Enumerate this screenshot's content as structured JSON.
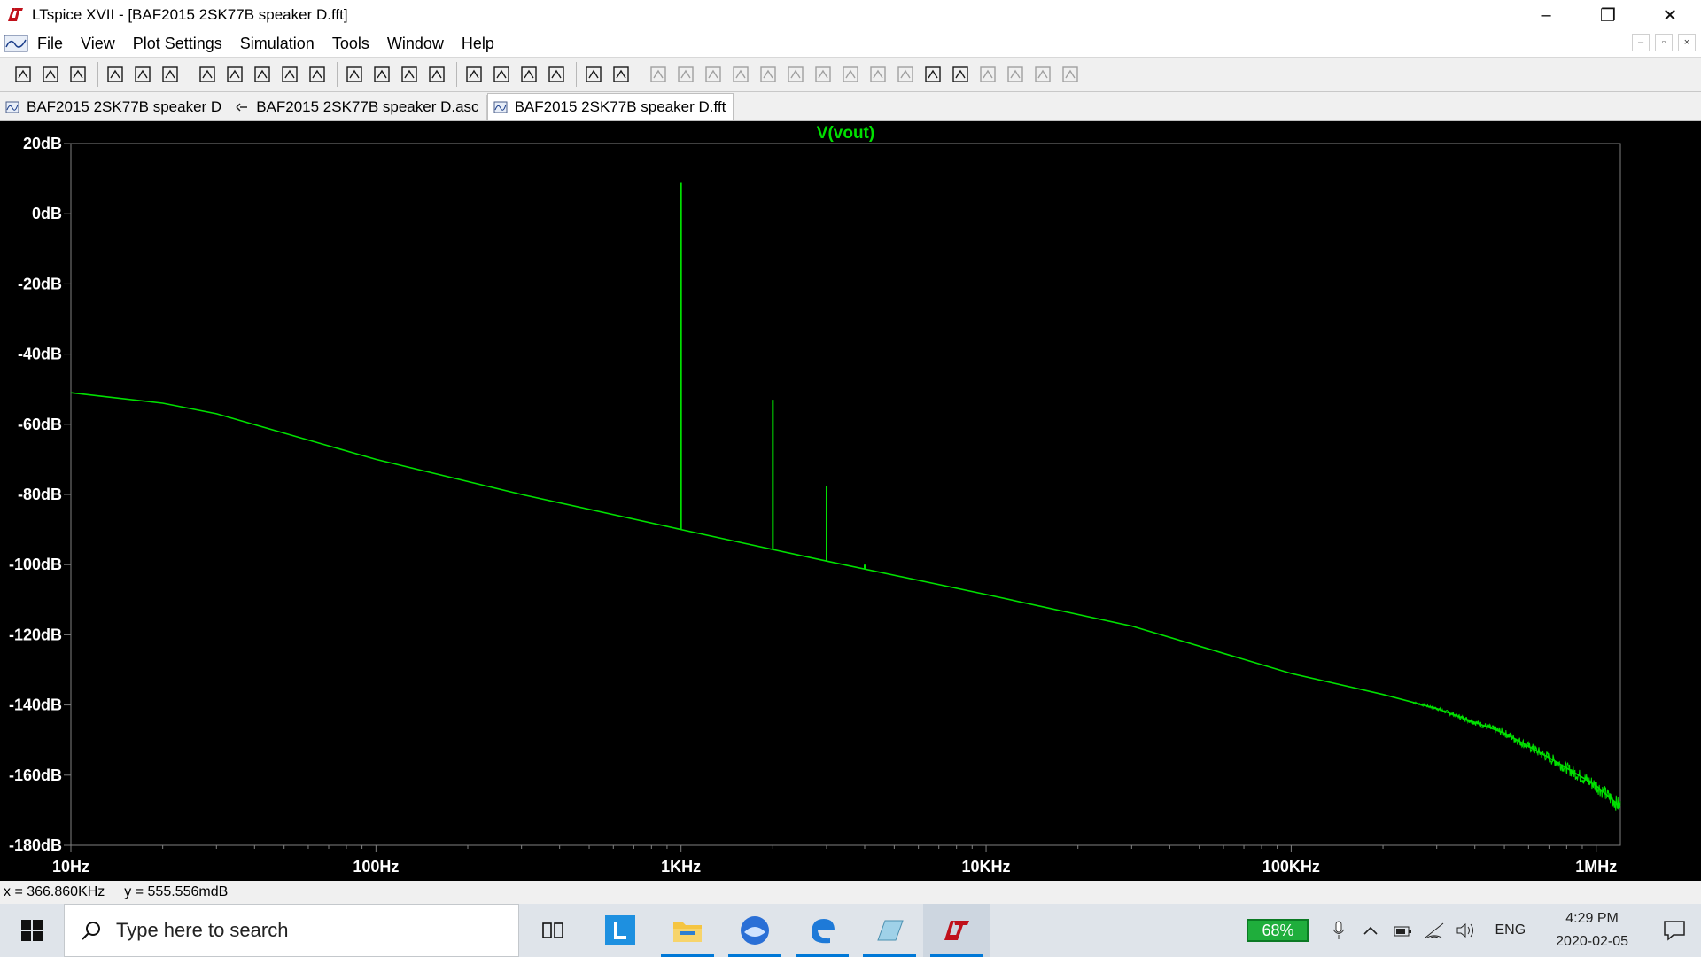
{
  "window": {
    "title": "LTspice XVII - [BAF2015 2SK77B speaker D.fft]",
    "controls": [
      "–",
      "❐",
      "✕"
    ]
  },
  "menu": [
    "File",
    "View",
    "Plot Settings",
    "Simulation",
    "Tools",
    "Window",
    "Help"
  ],
  "mdi_controls": [
    "–",
    "▫",
    "×"
  ],
  "toolbar": {
    "buttons": [
      "run-icon",
      "open-icon",
      "save-icon",
      "control-panel-icon",
      "halt-icon",
      "pan-hand-icon",
      "zoom-in-icon",
      "zoom-box-icon",
      "zoom-out-icon",
      "zoom-fit-icon",
      "autoscale-icon",
      "add-trace-icon",
      "tile-horizontal-icon",
      "tile-vertical-icon",
      "cascade-icon",
      "cut-icon",
      "copy-icon",
      "paste-icon",
      "find-icon",
      "print-icon",
      "print-setup-icon",
      "draw-wire-icon",
      "ground-icon",
      "label-net-icon",
      "resistor-icon",
      "capacitor-icon",
      "inductor-icon",
      "diode-icon",
      "component-icon",
      "move-icon",
      "drag-icon",
      "undo-icon",
      "redo-icon",
      "rotate-icon",
      "mirror-icon",
      "text-icon",
      "spice-directive-icon"
    ]
  },
  "tabs": [
    {
      "label": "BAF2015 2SK77B speaker D",
      "active": false,
      "icon": "waveform-icon"
    },
    {
      "label": "BAF2015 2SK77B speaker D.asc",
      "active": false,
      "icon": "schematic-icon"
    },
    {
      "label": "BAF2015 2SK77B speaker D.fft",
      "active": true,
      "icon": "waveform-icon"
    }
  ],
  "chart_data": {
    "type": "line",
    "title": "V(vout)",
    "xlabel": "",
    "ylabel": "",
    "xscale": "log",
    "xlim": [
      10,
      1200000
    ],
    "ylim": [
      -180,
      20
    ],
    "x_ticks": [
      "10Hz",
      "100Hz",
      "1KHz",
      "10KHz",
      "100KHz",
      "1MHz"
    ],
    "x_tick_values": [
      10,
      100,
      1000,
      10000,
      100000,
      1000000
    ],
    "y_ticks": [
      "20dB",
      "0dB",
      "-20dB",
      "-40dB",
      "-60dB",
      "-80dB",
      "-100dB",
      "-120dB",
      "-140dB",
      "-160dB",
      "-180dB"
    ],
    "y_tick_values": [
      20,
      0,
      -20,
      -40,
      -60,
      -80,
      -100,
      -120,
      -140,
      -160,
      -180
    ],
    "grid": false,
    "trace_color": "#00e000",
    "series": [
      {
        "name": "V(vout)",
        "x": [
          10,
          20,
          30,
          100,
          300,
          1000,
          3000,
          10000,
          30000,
          100000,
          200000,
          300000,
          500000,
          700000,
          1000000,
          1200000
        ],
        "y": [
          -51,
          -54,
          -57,
          -70,
          -80,
          -90,
          -99,
          -108.5,
          -117.5,
          -131,
          -137,
          -141,
          -148,
          -155,
          -163,
          -169
        ]
      }
    ],
    "spikes": [
      {
        "x": 1000,
        "y": 9
      },
      {
        "x": 2000,
        "y": -53
      },
      {
        "x": 3000,
        "y": -77.5
      },
      {
        "x": 4000,
        "y": -100
      }
    ]
  },
  "status": {
    "x_readout": "x = 366.860KHz",
    "y_readout": "y = 555.556mdB"
  },
  "taskbar": {
    "search_placeholder": "Type here to search",
    "apps": [
      "task-view-icon",
      "l-app-icon",
      "file-explorer-icon",
      "thunderbird-icon",
      "edge-icon",
      "notepad-icon",
      "ltspice-icon"
    ],
    "battery": "68%",
    "language": "ENG",
    "time": "4:29 PM",
    "date": "2020-02-05"
  },
  "colors": {
    "plot_bg": "#000000",
    "trace": "#00e000",
    "axis": "#808080",
    "title": "#00e000",
    "tick_label": "#ffffff"
  }
}
